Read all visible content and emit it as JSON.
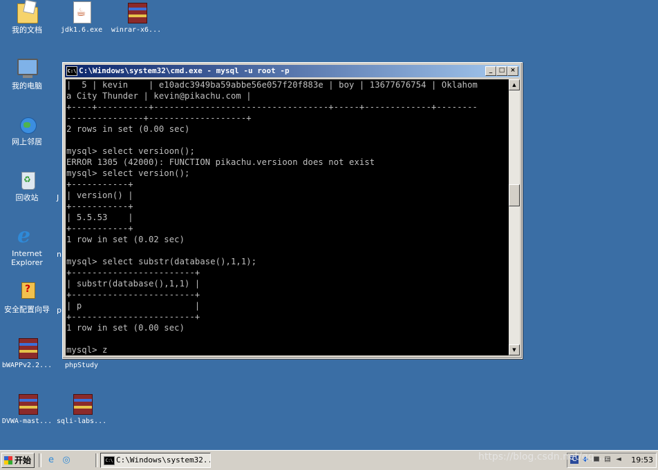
{
  "desktop": {
    "icons": {
      "my_documents": "我的文档",
      "jdk": "jdk1.6.exe",
      "winrar": "winrar-x6...",
      "my_computer": "我的电脑",
      "network": "网上邻居",
      "recycle_bin": "回收站",
      "ie_line1": "Internet",
      "ie_line2": "Explorer",
      "security_wizard": "安全配置向导",
      "bwapp": "bWAPPv2.2...",
      "phpstudy": "phpStudy",
      "dvwa": "DVWA-mast...",
      "sqli_labs": "sqli-labs..."
    },
    "partial_labels": {
      "j": "J",
      "n": "n",
      "p": "p"
    }
  },
  "console_window": {
    "title": "C:\\Windows\\system32\\cmd.exe - mysql -u root -p",
    "app_icon": "C:\\",
    "minimize_label": "_",
    "maximize_label": "□",
    "close_label": "×",
    "lines": [
      "|  5 | kevin    | e10adc3949ba59abbe56e057f20f883e | boy | 13677676754 | Oklahom",
      "a City Thunder | kevin@pikachu.com |",
      "+----+----------+----------------------------------+-----+-------------+--------",
      "---------------+-------------------+",
      "2 rows in set (0.00 sec)",
      "",
      "mysql> select versioon();",
      "ERROR 1305 (42000): FUNCTION pikachu.versioon does not exist",
      "mysql> select version();",
      "+-----------+",
      "| version() |",
      "+-----------+",
      "| 5.5.53    |",
      "+-----------+",
      "1 row in set (0.02 sec)",
      "",
      "mysql> select substr(database(),1,1);",
      "+------------------------+",
      "| substr(database(),1,1) |",
      "+------------------------+",
      "| p                      |",
      "+------------------------+",
      "1 row in set (0.00 sec)",
      "",
      "mysql> z"
    ]
  },
  "taskbar": {
    "start_label": "开始",
    "task_title": "C:\\Windows\\system32...",
    "task_icon": "C:\\",
    "clock": "19:53",
    "watermark": "https://blog.csdn.net/qq_..."
  },
  "icon_names": [
    "folder-icon",
    "java-icon",
    "winrar-icon",
    "computer-icon",
    "network-icon",
    "recycle-bin-icon",
    "ie-icon",
    "wizard-icon"
  ]
}
